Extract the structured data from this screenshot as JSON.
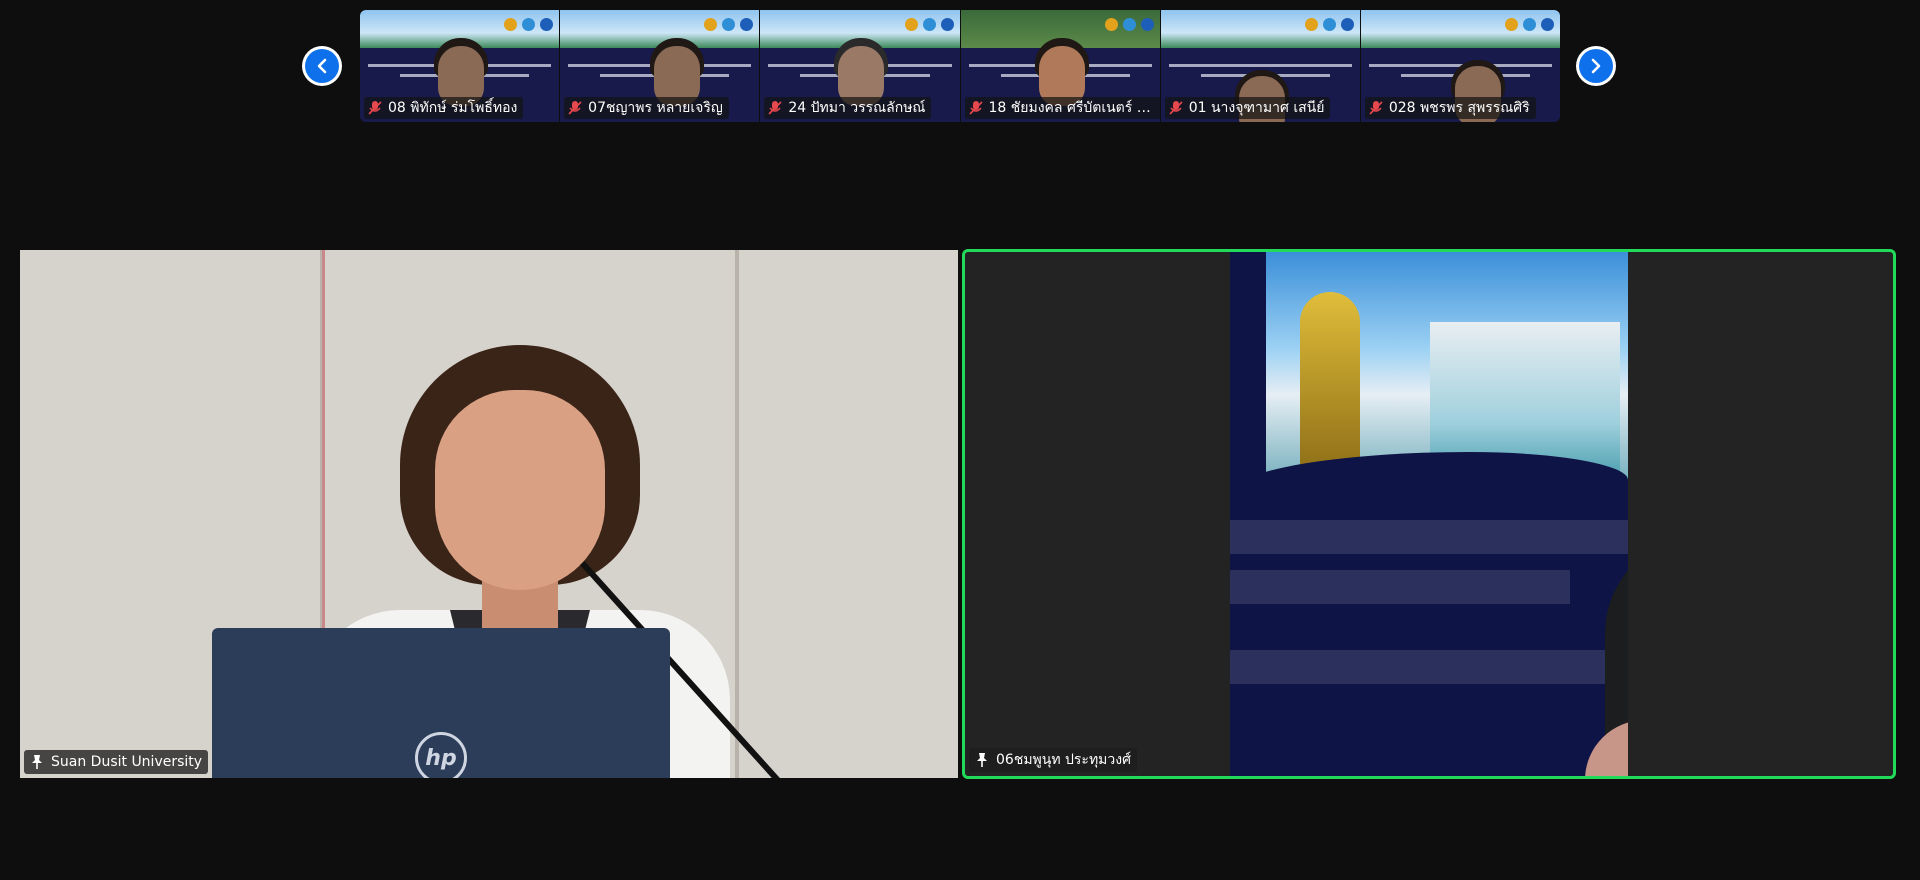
{
  "gallery": {
    "participants": [
      {
        "name": "08 พิทักษ์ ร่มโพธิ์ทอง",
        "muted": true
      },
      {
        "name": "07ชญาพร หลายเจริญ",
        "muted": true
      },
      {
        "name": "24 ปัทมา วรรณลักษณ์",
        "muted": true
      },
      {
        "name": "18 ชัยมงคล ศรีบัตเนตร์ ว...",
        "muted": true
      },
      {
        "name": "01 นางจุฑามาศ เสนีย์",
        "muted": true
      },
      {
        "name": "028 พชรพร สุพรรณศิริ",
        "muted": true
      }
    ]
  },
  "main": {
    "left_tile": {
      "name": "Suan Dusit University",
      "pinned": true
    },
    "right_tile": {
      "name": "06ชมพูนุท ประทุมวงศ์",
      "pinned": true,
      "active_speaker": true
    }
  },
  "colors": {
    "active_speaker_border": "#23d959",
    "nav_button": "#0e71eb",
    "muted_icon": "#e5484d"
  },
  "icons": {
    "prev": "chevron-left-icon",
    "next": "chevron-right-icon",
    "muted": "mic-muted-icon",
    "pin": "pin-icon"
  }
}
